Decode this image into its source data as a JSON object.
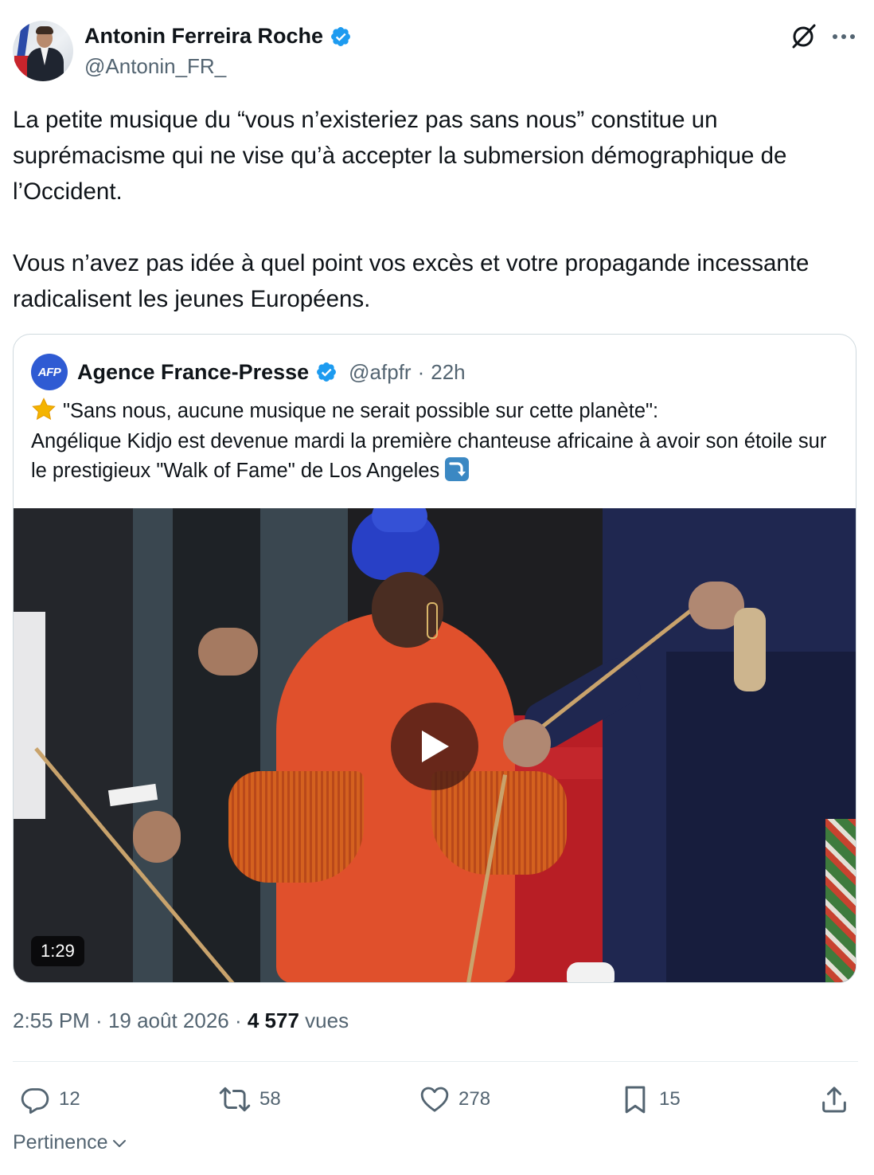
{
  "author": {
    "display_name": "Antonin Ferreira Roche",
    "handle": "@Antonin_FR_",
    "verified": true
  },
  "header_icons": [
    "grok-icon",
    "more-icon"
  ],
  "tweet": {
    "text": "La petite musique du “vous n’existeriez pas sans nous” constitue un suprémacisme qui ne vise qu’à accepter la submersion démographique de l’Occident.\n\nVous n’avez pas idée à quel point vos excès et votre propagande incessante radicalisent les jeunes Européens."
  },
  "quoted": {
    "avatar_label": "AFP",
    "display_name": "Agence France-Presse",
    "handle": "@afpfr",
    "separator": "·",
    "time": "22h",
    "text_line1": "\"Sans nous, aucune musique ne serait possible sur cette planète\":",
    "text_rest": "Angélique Kidjo est devenue mardi la première chanteuse africaine à avoir son étoile sur le prestigieux \"Walk of Fame\" de Los Angeles",
    "video_duration": "1:29"
  },
  "meta": {
    "time": "2:55 PM",
    "sep1": " · ",
    "date": "19 août 2026",
    "sep2": " · ",
    "views": "4 577",
    "views_label": " vues"
  },
  "actions": {
    "replies": "12",
    "reposts": "58",
    "likes": "278",
    "bookmarks": "15"
  },
  "sort": {
    "label": "Pertinence"
  },
  "colors": {
    "text": "#0f1419",
    "secondary": "#536471",
    "verified": "#1d9bf0",
    "border": "#cfd9de"
  }
}
